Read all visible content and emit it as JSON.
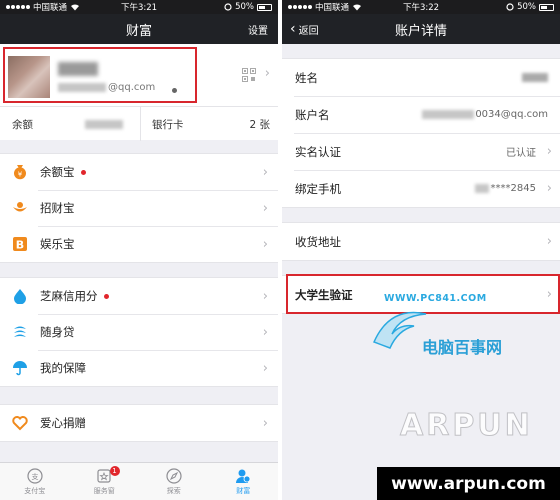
{
  "left": {
    "status": {
      "carrier": "中国联通",
      "time": "下午3:21",
      "battery": "50%"
    },
    "nav": {
      "title": "财富",
      "right": "设置"
    },
    "profile": {
      "email_suffix": "@qq.com"
    },
    "balance": {
      "label": "余额",
      "bank_label": "银行卡",
      "bank_count": "2 张"
    },
    "group1": [
      {
        "label": "余额宝",
        "icon": "yuebao-icon"
      },
      {
        "label": "招财宝",
        "icon": "zhaocaibao-icon"
      },
      {
        "label": "娱乐宝",
        "icon": "yulebao-icon"
      }
    ],
    "group2": [
      {
        "label": "芝麻信用分",
        "icon": "zhima-icon"
      },
      {
        "label": "随身贷",
        "icon": "suishendai-icon"
      },
      {
        "label": "我的保障",
        "icon": "umbrella-icon"
      }
    ],
    "group3": [
      {
        "label": "爱心捐赠",
        "icon": "heart-icon"
      }
    ],
    "tabs": [
      {
        "label": "支付宝",
        "icon": "alipay-icon"
      },
      {
        "label": "服务窗",
        "icon": "service-window-icon",
        "badge": "1"
      },
      {
        "label": "探索",
        "icon": "explore-icon"
      },
      {
        "label": "财富",
        "icon": "wealth-icon"
      }
    ],
    "colors": {
      "accent": "#1e9bf0",
      "nav": "#202226",
      "highlight": "#d8262d",
      "dot": "#e1262c",
      "bg": "#efeff4"
    }
  },
  "right": {
    "status": {
      "carrier": "中国联通",
      "time": "下午3:22",
      "battery": "50%"
    },
    "nav": {
      "title": "账户详情",
      "back": "返回"
    },
    "rows": [
      {
        "label": "姓名",
        "value": ""
      },
      {
        "label": "账户名",
        "value": "0034@qq.com"
      },
      {
        "label": "实名认证",
        "value": "已认证"
      },
      {
        "label": "绑定手机",
        "value": "****2845"
      }
    ],
    "address": {
      "label": "收货地址"
    },
    "student": {
      "label": "大学生验证"
    }
  },
  "watermark": {
    "url": "WWW.PC841.COM",
    "cn": "电脑百事网",
    "arpun": "ARPUN",
    "site": "www.arpun.com"
  }
}
